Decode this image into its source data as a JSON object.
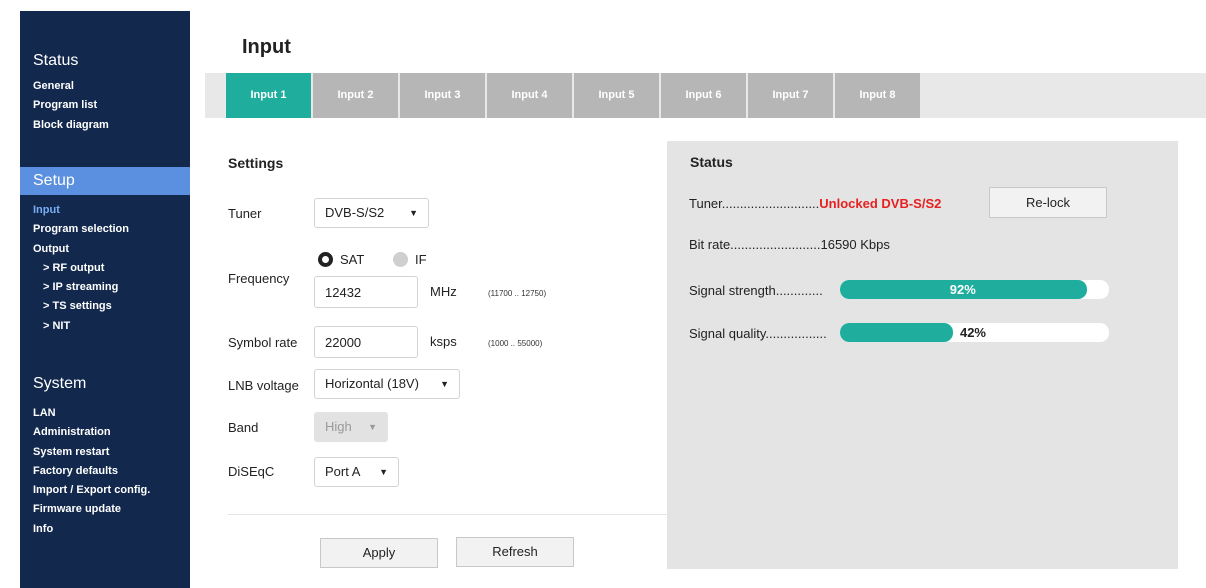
{
  "sidebar": {
    "sections": [
      {
        "title": "Status",
        "items": [
          "General",
          "Program list",
          "Block diagram"
        ]
      },
      {
        "title": "Setup",
        "items": [
          "Input",
          "Program selection",
          "Output",
          "> RF output",
          "> IP streaming",
          "> TS settings",
          "> NIT"
        ]
      },
      {
        "title": "System",
        "items": [
          "LAN",
          "Administration",
          "System restart",
          "Factory defaults",
          "Import / Export config.",
          "Firmware update",
          "Info"
        ]
      }
    ],
    "active_section": "Setup",
    "active_item": "Input"
  },
  "page_title": "Input",
  "tabs": [
    "Input 1",
    "Input 2",
    "Input 3",
    "Input 4",
    "Input 5",
    "Input 6",
    "Input 7",
    "Input 8"
  ],
  "active_tab": "Input 1",
  "settings": {
    "title": "Settings",
    "tuner": {
      "label": "Tuner",
      "value": "DVB-S/S2"
    },
    "frequency": {
      "label": "Frequency",
      "radio_sat": "SAT",
      "radio_if": "IF",
      "selected": "SAT",
      "value": "12432",
      "unit": "MHz",
      "range": "(11700 .. 12750)"
    },
    "symbol_rate": {
      "label": "Symbol rate",
      "value": "22000",
      "unit": "ksps",
      "range": "(1000 .. 55000)"
    },
    "lnb_voltage": {
      "label": "LNB voltage",
      "value": "Horizontal (18V)"
    },
    "band": {
      "label": "Band",
      "value": "High"
    },
    "diseqc": {
      "label": "DiSEqC",
      "value": "Port A"
    },
    "apply_label": "Apply",
    "refresh_label": "Refresh"
  },
  "status": {
    "title": "Status",
    "tuner_label": "Tuner...........................",
    "tuner_value": "Unlocked DVB-S/S2",
    "relock_label": "Re-lock",
    "bitrate_label": "Bit rate.........................",
    "bitrate_value": "16590 Kbps",
    "signal_strength_label": "Signal strength.............",
    "signal_strength_value": "92%",
    "signal_strength_percent": 92,
    "signal_quality_label": "Signal quality.................",
    "signal_quality_value": "42%",
    "signal_quality_percent": 42
  },
  "colors": {
    "sidebar_bg": "#12284d",
    "sidebar_active": "#5b8fdf",
    "accent": "#1fae9d",
    "error": "#e62020"
  }
}
